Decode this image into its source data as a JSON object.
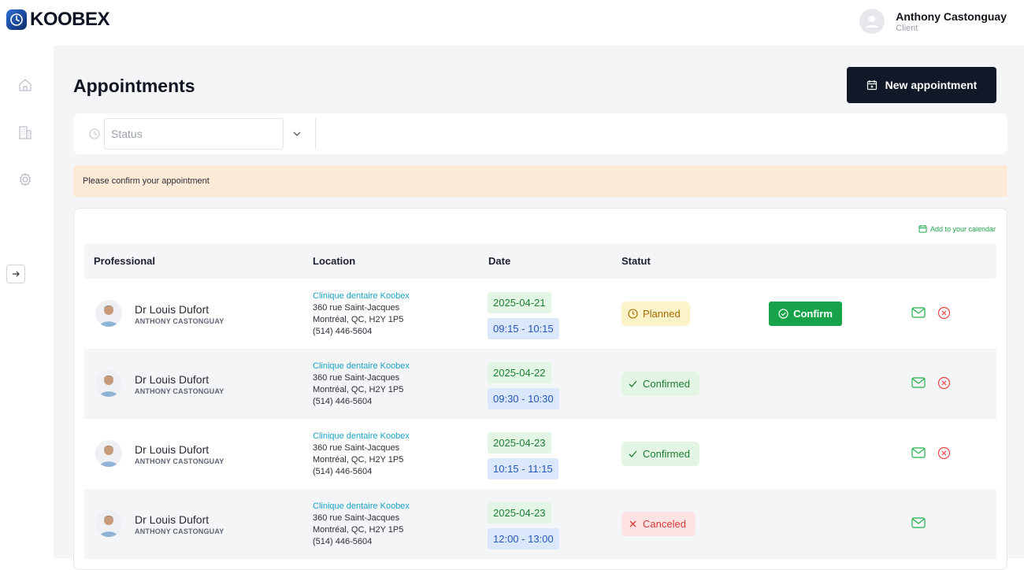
{
  "app": {
    "brand": "KOOBEX"
  },
  "user": {
    "name": "Anthony Castonguay",
    "role": "Client"
  },
  "sidebar": {
    "items": [
      "home-icon",
      "building-icon",
      "gear-icon"
    ],
    "collapse": "arrow-right-icon"
  },
  "page": {
    "title": "Appointments",
    "new_button": "New appointment"
  },
  "filter": {
    "placeholder": "Status"
  },
  "alert": {
    "text": "Please confirm your appointment"
  },
  "calendar_link": "Add to your calendar",
  "table": {
    "headers": {
      "professional": "Professional",
      "location": "Location",
      "date": "Date",
      "status": "Statut"
    },
    "rows": [
      {
        "name": "Dr Louis Dufort",
        "client": "ANTHONY CASTONGUAY",
        "clinic": "Clinique dentaire Koobex",
        "address1": "360 rue Saint-Jacques",
        "address2": "Montréal, QC, H2Y 1P5",
        "phone": "(514) 446-5604",
        "date": "2025-04-21",
        "time": "09:15 - 10:15",
        "status": "Planned",
        "action": "Confirm"
      },
      {
        "name": "Dr Louis Dufort",
        "client": "ANTHONY CASTONGUAY",
        "clinic": "Clinique dentaire Koobex",
        "address1": "360 rue Saint-Jacques",
        "address2": "Montréal, QC, H2Y 1P5",
        "phone": "(514) 446-5604",
        "date": "2025-04-22",
        "time": "09:30 - 10:30",
        "status": "Confirmed"
      },
      {
        "name": "Dr Louis Dufort",
        "client": "ANTHONY CASTONGUAY",
        "clinic": "Clinique dentaire Koobex",
        "address1": "360 rue Saint-Jacques",
        "address2": "Montréal, QC, H2Y 1P5",
        "phone": "(514) 446-5604",
        "date": "2025-04-23",
        "time": "10:15 - 11:15",
        "status": "Confirmed"
      },
      {
        "name": "Dr Louis Dufort",
        "client": "ANTHONY CASTONGUAY",
        "clinic": "Clinique dentaire Koobex",
        "address1": "360 rue Saint-Jacques",
        "address2": "Montréal, QC, H2Y 1P5",
        "phone": "(514) 446-5604",
        "date": "2025-04-23",
        "time": "12:00 - 13:00",
        "status": "Canceled"
      }
    ]
  },
  "colors": {
    "primary_dark": "#111827",
    "success": "#16a34a",
    "warning_bg": "#fdebd7",
    "link": "#1aa3c9",
    "danger": "#ef4444"
  }
}
